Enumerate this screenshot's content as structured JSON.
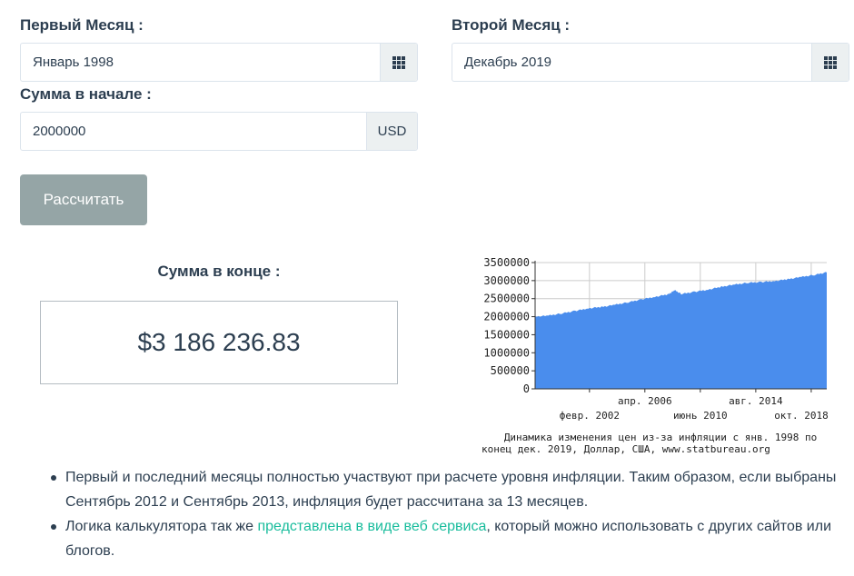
{
  "form": {
    "first_month_label": "Первый Месяц :",
    "first_month_value": "Январь 1998",
    "second_month_label": "Второй Месяц :",
    "second_month_value": "Декабрь 2019",
    "amount_label": "Сумма в начале :",
    "amount_value": "2000000",
    "currency": "USD",
    "calendar_icon": "calendar-grid-icon",
    "calculate_button": "Рассчитать"
  },
  "result": {
    "title": "Сумма в конце :",
    "value": "$3 186 236.83"
  },
  "chart_data": {
    "type": "area",
    "y_ticks": [
      "3500000",
      "3000000",
      "2500000",
      "2000000",
      "1500000",
      "1000000",
      "500000",
      "0"
    ],
    "ylim": [
      0,
      3500000
    ],
    "x_labels_top": [
      "апр. 2006",
      "авг. 2014"
    ],
    "x_labels_bottom": [
      "февр. 2002",
      "июнь 2010",
      "окт. 2018"
    ],
    "x": [
      "1998-01",
      "1999-01",
      "2000-01",
      "2001-01",
      "2002-01",
      "2003-01",
      "2004-01",
      "2005-01",
      "2006-01",
      "2007-01",
      "2008-01",
      "2008-07",
      "2009-01",
      "2010-01",
      "2011-01",
      "2012-01",
      "2013-01",
      "2014-01",
      "2015-01",
      "2016-01",
      "2017-01",
      "2018-01",
      "2019-01",
      "2019-12"
    ],
    "values": [
      2000000,
      2030000,
      2090000,
      2160000,
      2230000,
      2270000,
      2330000,
      2400000,
      2480000,
      2550000,
      2620000,
      2730000,
      2630000,
      2690000,
      2750000,
      2830000,
      2890000,
      2940000,
      2960000,
      2990000,
      3040000,
      3100000,
      3160000,
      3230000
    ],
    "color": "#4a8ded",
    "caption_line1": "Динамика изменения цен из-за инфляции с янв. 1998 по",
    "caption_line2": "конец дек. 2019, Доллар, США, www.statbureau.org",
    "grid": true
  },
  "notes": {
    "item1": "Первый и последний месяцы полностью участвуют при расчете уровня инфляции. Таким образом, если выбраны Сентябрь 2012 и Сентябрь 2013, инфляция будет рассчитана за 13 месяцев.",
    "item2_prefix": "Логика калькулятора так же ",
    "item2_link": "представлена в виде веб сервиса",
    "item2_suffix": ", который можно использовать с других сайтов или блогов."
  },
  "colors": {
    "text": "#2c3e50",
    "button": "#95a5a6",
    "link": "#18bc9c",
    "chart_fill": "#4a8ded"
  }
}
